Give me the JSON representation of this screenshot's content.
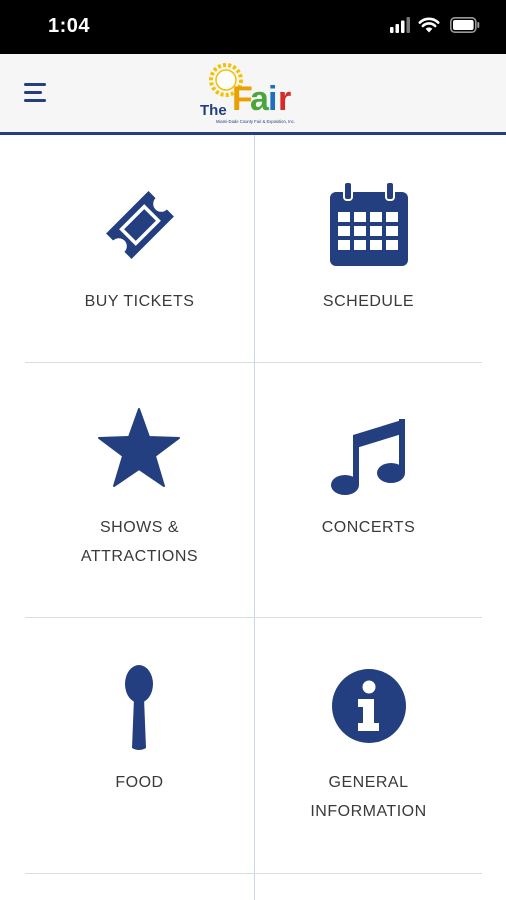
{
  "status_bar": {
    "time": "1:04",
    "icons": [
      "signal-icon",
      "wifi-icon",
      "battery-icon"
    ]
  },
  "header": {
    "menu_icon": "hamburger-menu-icon",
    "logo": {
      "word_the": "The",
      "word_fair": "Fair",
      "tagline": "Miami-Dade County Fair & Exposition, Inc."
    }
  },
  "tiles": [
    {
      "id": "buy-tickets",
      "icon": "ticket-icon",
      "lines": [
        "BUY TICKETS"
      ]
    },
    {
      "id": "schedule",
      "icon": "calendar-icon",
      "lines": [
        "SCHEDULE"
      ]
    },
    {
      "id": "shows-attractions",
      "icon": "star-icon",
      "lines": [
        "SHOWS &",
        "ATTRACTIONS"
      ]
    },
    {
      "id": "concerts",
      "icon": "music-note-icon",
      "lines": [
        "CONCERTS"
      ]
    },
    {
      "id": "food",
      "icon": "spoon-icon",
      "lines": [
        "FOOD"
      ]
    },
    {
      "id": "general-information",
      "icon": "info-icon",
      "lines": [
        "GENERAL",
        "INFORMATION"
      ]
    }
  ],
  "colors": {
    "icon": "#243f80",
    "label": "#3a3a3a",
    "divider": "#d7dde8",
    "header_bg": "#f6f6f6",
    "accent_border": "#243f80"
  }
}
